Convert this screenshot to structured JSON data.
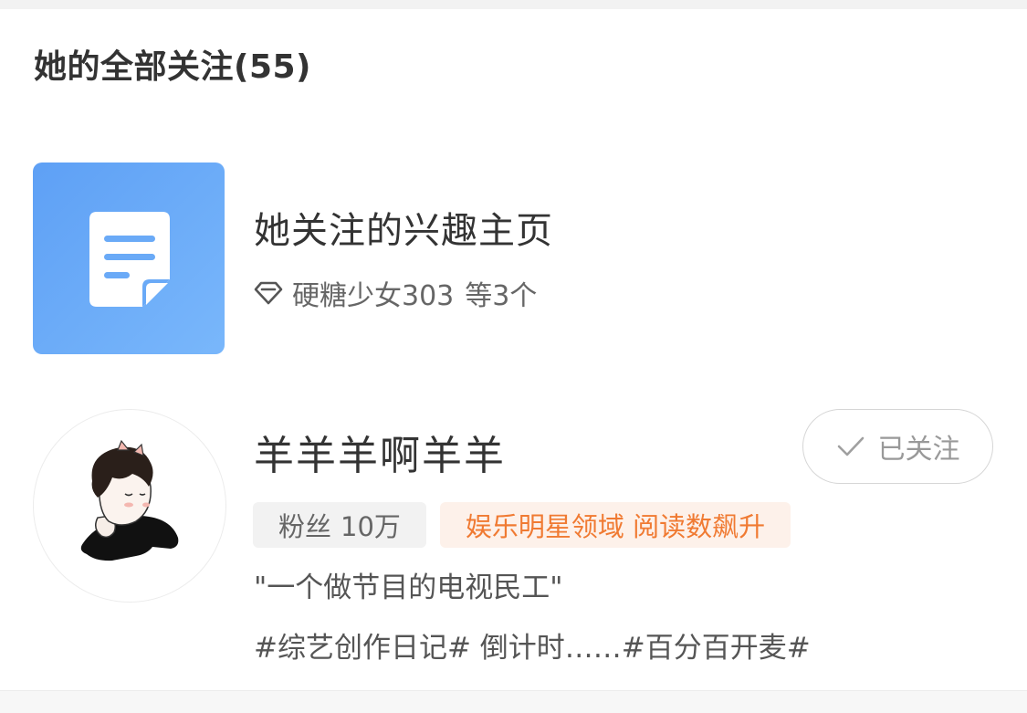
{
  "header": {
    "title": "她的全部关注(55)"
  },
  "interest": {
    "title": "她关注的兴趣主页",
    "icon": "document-icon",
    "sub_icon": "diamond-icon",
    "name": "硬糖少女303",
    "count": "等3个",
    "tile_color": "#6aaaf7"
  },
  "user": {
    "name": "羊羊羊啊羊羊",
    "follow_label": "已关注",
    "fans_label": "粉丝",
    "fans_value": "10万",
    "domain_tag": "娱乐明星领域 阅读数飙升",
    "bio": "\"一个做节目的电视民工\"",
    "recent": "#综艺创作日记# 倒计时……#百分百开麦#",
    "accent_color": "#f07a32"
  }
}
